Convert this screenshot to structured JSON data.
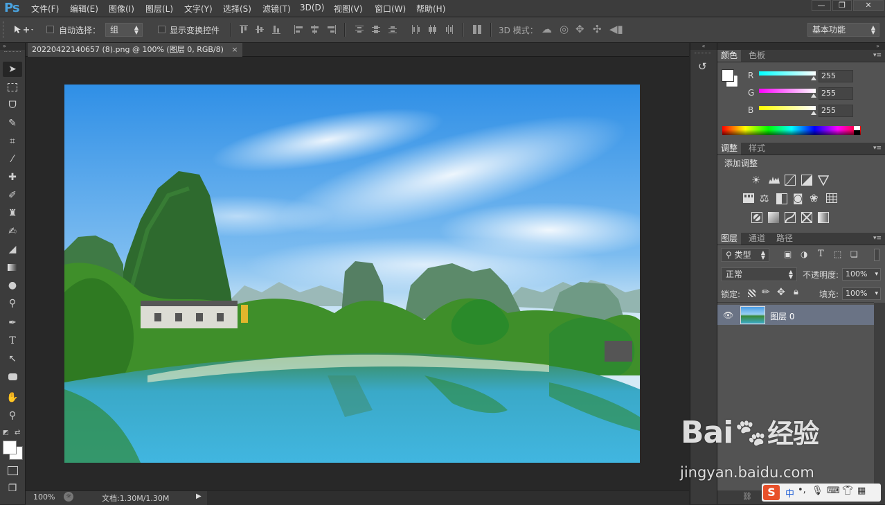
{
  "app": {
    "logo": "Ps",
    "window_controls": [
      "—",
      "❐",
      "✕"
    ]
  },
  "menu": [
    "文件(F)",
    "编辑(E)",
    "图像(I)",
    "图层(L)",
    "文字(Y)",
    "选择(S)",
    "滤镜(T)",
    "3D(D)",
    "视图(V)",
    "窗口(W)",
    "帮助(H)"
  ],
  "options": {
    "auto_select_label": "自动选择：",
    "auto_select_value": "组",
    "show_transform_label": "显示变换控件",
    "mode_3d_label": "3D 模式：",
    "workspace": "基本功能"
  },
  "document": {
    "tab_title": "20220422140657 (8).png @ 100% (图层 0, RGB/8)",
    "tab_close": "×",
    "zoom": "100%",
    "doc_size": "文档:1.30M/1.30M"
  },
  "color_panel": {
    "tabs": [
      "颜色",
      "色板"
    ],
    "channels": [
      {
        "label": "R",
        "value": "255"
      },
      {
        "label": "G",
        "value": "255"
      },
      {
        "label": "B",
        "value": "255"
      }
    ]
  },
  "adjust_panel": {
    "tabs": [
      "调整",
      "样式"
    ],
    "add_label": "添加调整",
    "icons": [
      [
        "brightness-icon",
        "levels-icon",
        "curves-icon",
        "exposure-icon",
        "vibrance-icon"
      ],
      [
        "hue-saturation-icon",
        "color-balance-icon",
        "black-white-icon",
        "photo-filter-icon",
        "channel-mixer-icon",
        "color-lookup-icon"
      ],
      [
        "invert-icon",
        "posterize-icon",
        "threshold-icon",
        "selective-color-icon",
        "gradient-map-icon"
      ]
    ]
  },
  "layers_panel": {
    "tabs": [
      "图层",
      "通道",
      "路径"
    ],
    "filter_kind": "类型",
    "blend_mode": "正常",
    "opacity_label": "不透明度:",
    "opacity_value": "100%",
    "lock_label": "锁定:",
    "fill_label": "填充:",
    "fill_value": "100%",
    "layers": [
      {
        "name": "图层 0",
        "visible": true
      }
    ]
  },
  "watermark": {
    "brand": "Bai",
    "brand_suffix": "经验",
    "url": "jingyan.baidu.com",
    "ime": "中"
  }
}
